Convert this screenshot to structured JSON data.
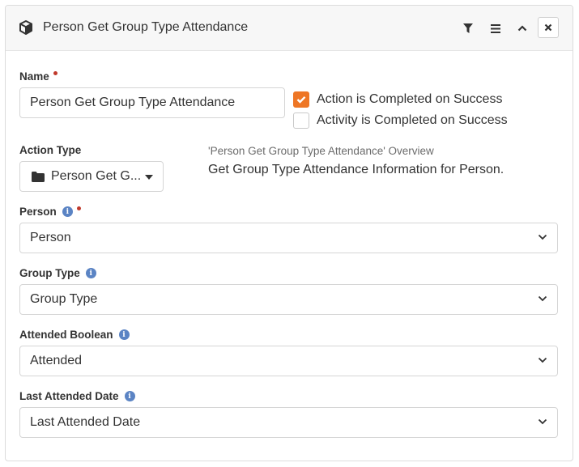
{
  "header": {
    "title": "Person Get Group Type Attendance",
    "icons": [
      "cube-icon",
      "filter-icon",
      "hamburger-icon",
      "chevron-up-icon",
      "close-icon"
    ]
  },
  "form": {
    "name": {
      "label": "Name",
      "required": true,
      "value": "Person Get Group Type Attendance"
    },
    "action_completed": {
      "label": "Action is Completed on Success",
      "checked": true
    },
    "activity_completed": {
      "label": "Activity is Completed on Success",
      "checked": false
    },
    "action_type": {
      "label": "Action Type",
      "value": "Person Get G...",
      "icon": "folder-icon"
    },
    "overview": {
      "title": "'Person Get Group Type Attendance' Overview",
      "text": "Get Group Type Attendance Information for Person."
    },
    "person": {
      "label": "Person",
      "required": true,
      "value": "Person"
    },
    "group_type": {
      "label": "Group Type",
      "value": "Group Type"
    },
    "attended_boolean": {
      "label": "Attended Boolean",
      "value": "Attended"
    },
    "last_attended_date": {
      "label": "Last Attended Date",
      "value": "Last Attended Date"
    }
  },
  "colors": {
    "accent": "#ee7625",
    "info": "#5b84c4",
    "required": "#c0392b"
  }
}
